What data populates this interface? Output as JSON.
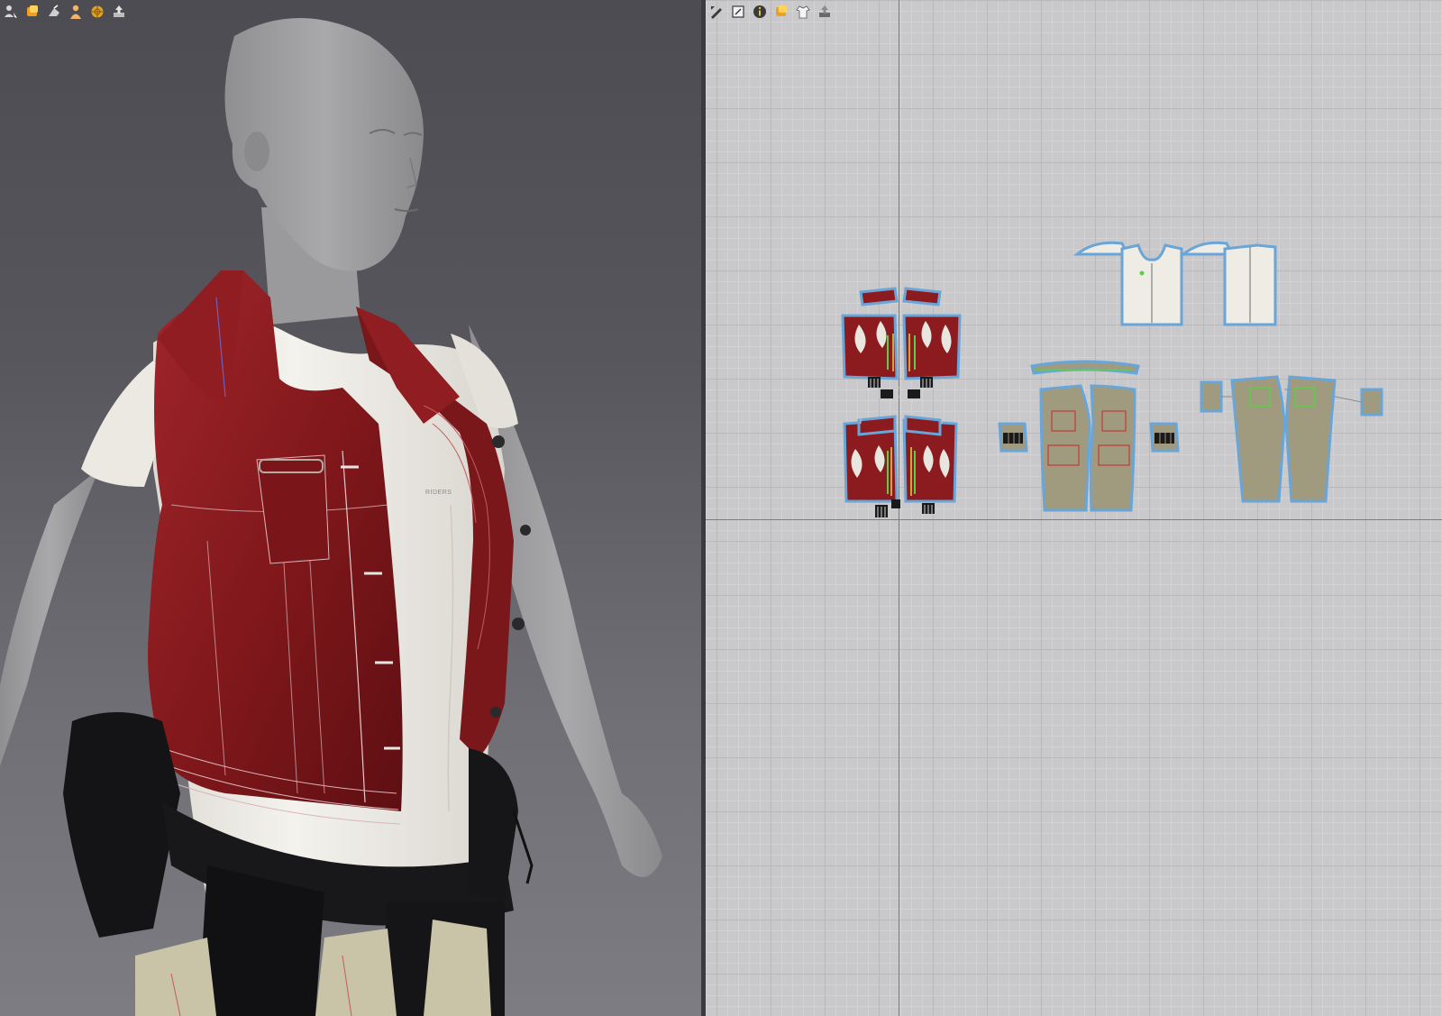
{
  "app": {
    "viewport_3d": {
      "toolbar": [
        {
          "icon": "avatar-select-icon"
        },
        {
          "icon": "fabric-icon"
        },
        {
          "icon": "pose-icon"
        },
        {
          "icon": "avatar-icon"
        },
        {
          "icon": "texture-sphere-icon"
        },
        {
          "icon": "export-icon"
        }
      ],
      "shirt_logo_text": "RIDERS"
    },
    "viewport_2d": {
      "toolbar": [
        {
          "icon": "edit-pattern-icon"
        },
        {
          "icon": "transform-pattern-icon"
        },
        {
          "icon": "info-icon"
        },
        {
          "icon": "fabric-icon"
        },
        {
          "icon": "garment-icon"
        },
        {
          "icon": "export-icon"
        }
      ],
      "pattern_groups": [
        {
          "name": "vest-patterns",
          "color": "#8c1b1f"
        },
        {
          "name": "tshirt-patterns",
          "color": "#efece6"
        },
        {
          "name": "pants-front-patterns",
          "color": "#a09a7e"
        },
        {
          "name": "pants-back-patterns",
          "color": "#a09a7e"
        }
      ],
      "outline_color": "#6aa5d8"
    },
    "colors": {
      "leather": "#8c1b1f",
      "shirt": "#f1efea",
      "mannequin": "#9d9d9f",
      "belt": "#141416",
      "pants": "#c9c4a8"
    }
  }
}
